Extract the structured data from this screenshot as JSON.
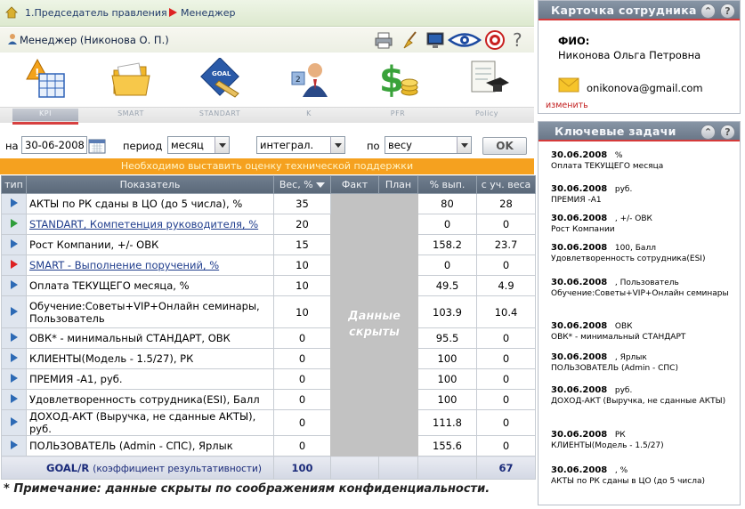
{
  "breadcrumb": {
    "level1": "1.Председатель правления",
    "level2": "Менеджер"
  },
  "user": {
    "text": "Менеджер  (Никонова О. П.)"
  },
  "toolbar": {
    "buttons": [
      {
        "label": "KPI",
        "icon": "kpi-warning-table-icon"
      },
      {
        "label": "SMART",
        "icon": "folder-icon"
      },
      {
        "label": "STANDART",
        "icon": "goal-ruler-icon"
      },
      {
        "label": "K",
        "icon": "manager-person-icon"
      },
      {
        "label": "PFR",
        "icon": "dollar-coins-icon"
      },
      {
        "label": "Policy",
        "icon": "diploma-cap-icon"
      }
    ]
  },
  "filters": {
    "date_label": "на",
    "date_value": "30-06-2008",
    "period_label": "период",
    "period_value": "месяц",
    "mode_value": "интеграл.",
    "by_label": "по",
    "by_value": "весу",
    "ok_label": "OK"
  },
  "warning": "Необходимо выставить оценку технической поддержки",
  "table": {
    "headers": {
      "type": "тип",
      "indicator": "Показатель",
      "weight": "Вес, %",
      "fact": "Факт",
      "plan": "План",
      "pct": "% вып.",
      "weighted": "с уч. веса"
    },
    "hidden_text_1": "Данные",
    "hidden_text_2": "скрыты",
    "rows": [
      {
        "marker": "blue",
        "name": "АКТЫ по РК сданы в ЦО (до 5 числа), %",
        "link": false,
        "weight": "35",
        "pct": "80",
        "weighted": "28"
      },
      {
        "marker": "green",
        "name": "STANDART, Компетенция руководителя, %",
        "link": true,
        "weight": "20",
        "pct": "0",
        "weighted": "0"
      },
      {
        "marker": "blue",
        "name": "Рост Компании, +/- ОВК",
        "link": false,
        "weight": "15",
        "pct": "158.2",
        "weighted": "23.7"
      },
      {
        "marker": "red",
        "name": "SMART - Выполнение поручений, %",
        "link": true,
        "weight": "10",
        "pct": "0",
        "weighted": "0"
      },
      {
        "marker": "blue",
        "name": "Оплата ТЕКУЩЕГО месяца, %",
        "link": false,
        "weight": "10",
        "pct": "49.5",
        "weighted": "4.9"
      },
      {
        "marker": "blue",
        "name": "Обучение:Советы+VIP+Онлайн семинары, Пользователь",
        "link": false,
        "weight": "10",
        "pct": "103.9",
        "weighted": "10.4"
      },
      {
        "marker": "blue",
        "name": "ОВК* - минимальный СТАНДАРТ, ОВК",
        "link": false,
        "weight": "0",
        "pct": "95.5",
        "weighted": "0"
      },
      {
        "marker": "blue",
        "name": "КЛИЕНТЫ(Модель - 1.5/27), РК",
        "link": false,
        "weight": "0",
        "pct": "100",
        "weighted": "0"
      },
      {
        "marker": "blue",
        "name": "ПРЕМИЯ -А1, руб.",
        "link": false,
        "weight": "0",
        "pct": "100",
        "weighted": "0"
      },
      {
        "marker": "blue",
        "name": "Удовлетворенность сотрудника(ESI), Балл",
        "link": false,
        "weight": "0",
        "pct": "100",
        "weighted": "0"
      },
      {
        "marker": "blue",
        "name": "ДОХОД-АКТ (Выручка, не сданные АКТЫ), руб.",
        "link": false,
        "weight": "0",
        "pct": "111.8",
        "weighted": "0"
      },
      {
        "marker": "blue",
        "name": "ПОЛЬЗОВАТЕЛЬ (Admin - СПС), Ярлык",
        "link": false,
        "weight": "0",
        "pct": "155.6",
        "weighted": "0"
      }
    ],
    "footer": {
      "goal": "GOAL/R",
      "coef": "(коэффициент результативности)",
      "weight_total": "100",
      "weighted_total": "67"
    }
  },
  "note": "* Примечание: данные скрыты по соображениям конфиденциальности.",
  "card": {
    "title": "Карточка сотрудника",
    "fio_label": "ФИО:",
    "fio_value": "Никонова Ольга Петровна",
    "email": "onikonova@gmail.com",
    "edit": "изменить"
  },
  "tasks": {
    "title": "Ключевые задачи",
    "items": [
      {
        "date": "30.06.2008",
        "unit": "%",
        "name": "Оплата ТЕКУЩЕГО месяца"
      },
      {
        "date": "30.06.2008",
        "unit": "руб.",
        "name": "ПРЕМИЯ -А1"
      },
      {
        "date": "30.06.2008",
        "unit": ", +/- ОВК",
        "name": "Рост Компании"
      },
      {
        "date": "30.06.2008",
        "unit": "100, Балл",
        "name": "Удовлетворенность сотрудника(ESI)"
      },
      {
        "date": "30.06.2008",
        "unit": ", Пользователь",
        "name": "Обучение:Советы+VIP+Онлайн семинары"
      },
      {
        "date": "30.06.2008",
        "unit": "ОВК",
        "name": "ОВК* - минимальный СТАНДАРТ"
      },
      {
        "date": "30.06.2008",
        "unit": ", Ярлык",
        "name": "ПОЛЬЗОВАТЕЛЬ (Admin - СПС)"
      },
      {
        "date": "30.06.2008",
        "unit": "руб.",
        "name": "ДОХОД-АКТ (Выручка, не сданные АКТЫ)"
      },
      {
        "date": "30.06.2008",
        "unit": "РК",
        "name": "КЛИЕНТЫ(Модель - 1.5/27)"
      },
      {
        "date": "30.06.2008",
        "unit": ", %",
        "name": "АКТЫ по РК сданы в ЦО (до 5 числа)"
      }
    ]
  },
  "colors": {
    "accent_red": "#d53a3a",
    "warning_orange": "#f5a11f",
    "header_gray": "#6a7788",
    "link_blue": "#1e3c8c"
  }
}
